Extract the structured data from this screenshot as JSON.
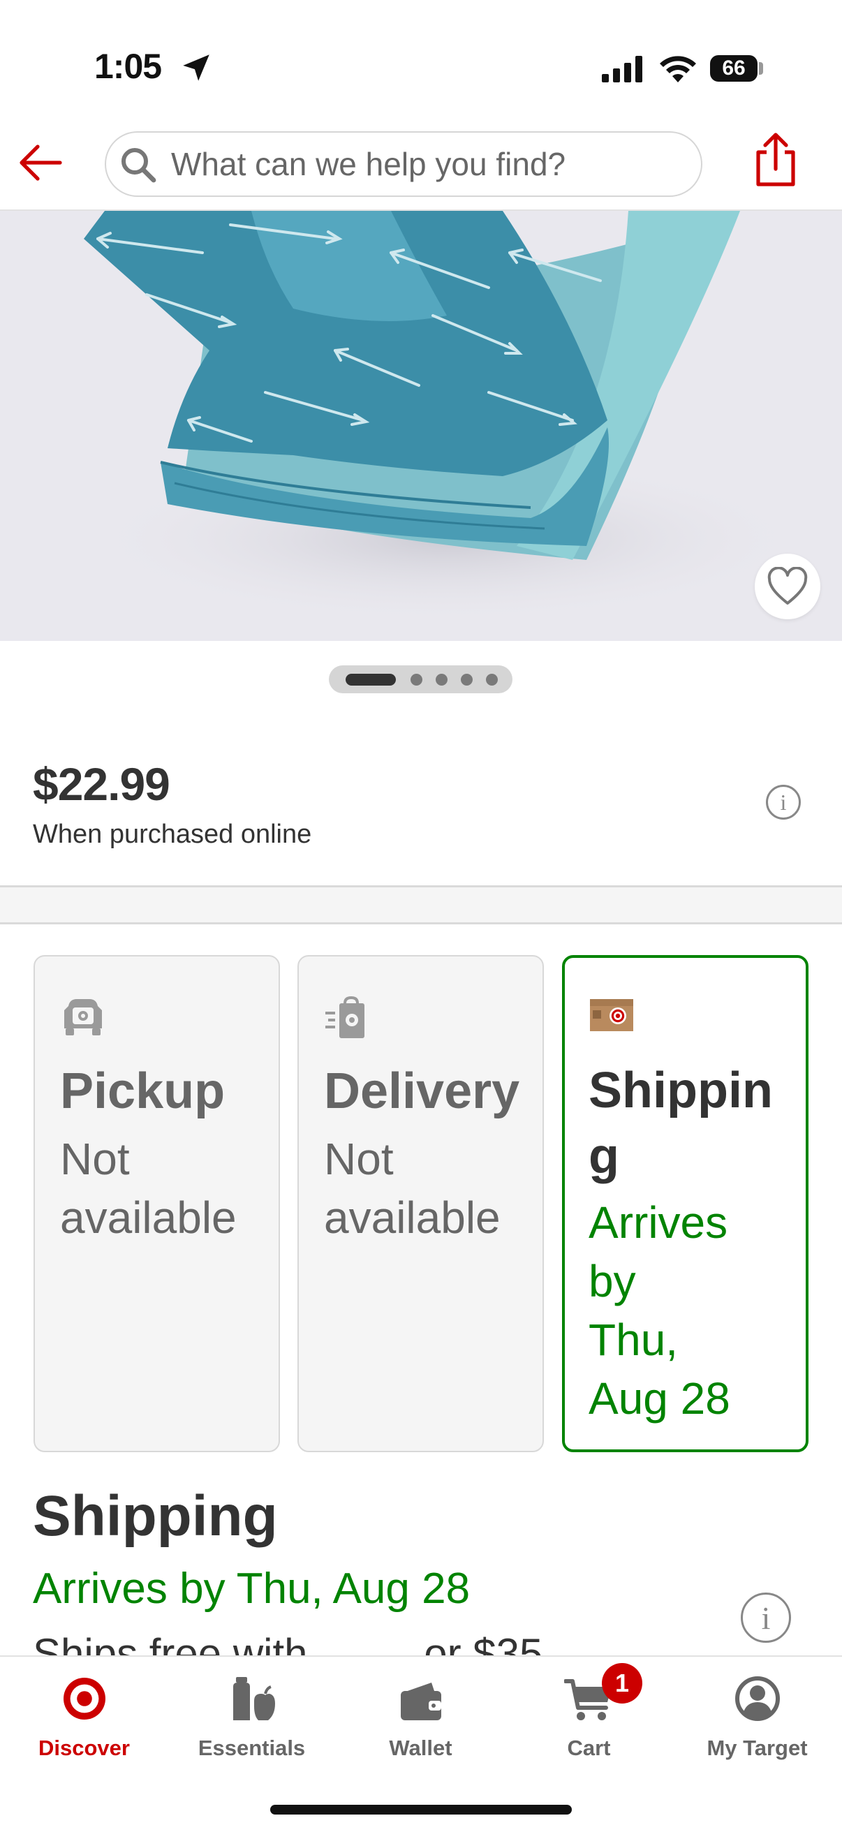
{
  "status_bar": {
    "time": "1:05",
    "battery": "66"
  },
  "header": {
    "search_placeholder": "What can we help you find?"
  },
  "product": {
    "price": "$22.99",
    "price_note": "When purchased online",
    "image_count": 5,
    "active_image": 1
  },
  "fulfillment": [
    {
      "title": "Pickup",
      "status": "Not available",
      "selected": false,
      "icon": "pickup-car-icon"
    },
    {
      "title": "Delivery",
      "status": "Not available",
      "selected": false,
      "icon": "delivery-bag-icon"
    },
    {
      "title": "Shipping",
      "status": "Arrives by Thu, Aug 28",
      "selected": true,
      "icon": "shipping-box-icon"
    }
  ],
  "fulfillment_display": {
    "pickup_status": [
      "Not",
      "available"
    ],
    "delivery_status": [
      "Not",
      "available"
    ],
    "shipping_title": [
      "Shippin",
      "g"
    ],
    "shipping_status": [
      "Arrives",
      "by",
      "Thu,",
      "Aug 28"
    ]
  },
  "shipping_section": {
    "title": "Shipping",
    "arrives": "Arrives by Thu, Aug 28",
    "partial_text": "Ships free with ........ or $35"
  },
  "tabs": [
    {
      "label": "Discover",
      "icon": "target-logo-icon",
      "active": true
    },
    {
      "label": "Essentials",
      "icon": "essentials-icon",
      "active": false
    },
    {
      "label": "Wallet",
      "icon": "wallet-icon",
      "active": false
    },
    {
      "label": "Cart",
      "icon": "cart-icon",
      "active": false,
      "badge": "1"
    },
    {
      "label": "My Target",
      "icon": "account-icon",
      "active": false
    }
  ],
  "colors": {
    "brand_red": "#cc0000",
    "success_green": "#008300"
  }
}
